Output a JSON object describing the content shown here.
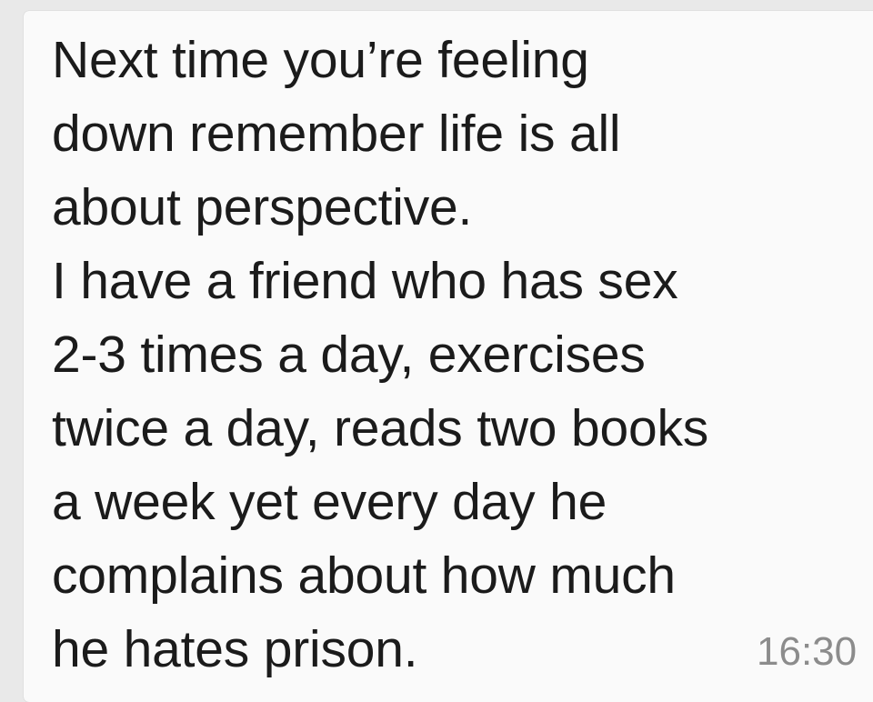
{
  "message": {
    "lines": [
      "Next time you’re feeling",
      "down remember life is all",
      "about perspective.",
      "I have a friend who has sex",
      "2-3 times a day, exercises",
      "twice a day, reads two books",
      "a week yet every day he",
      "complains about how much",
      "he hates prison."
    ],
    "time": "16:30"
  },
  "colors": {
    "background": "#e9e9e9",
    "bubble": "#fafafa",
    "text": "#1b1b1b",
    "timestamp": "#8c8c8c"
  }
}
